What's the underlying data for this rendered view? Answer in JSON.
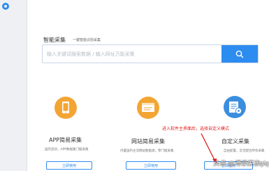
{
  "search": {
    "title": "智能采集",
    "hint": "一键智能识别采集",
    "placeholder": "输入关键词搜索数据 / 输入网址万能采集"
  },
  "cards": {
    "app": {
      "title": "APP简易采集",
      "desc": "国内首创，APP数据集门槛采集",
      "button": "立即使用"
    },
    "web": {
      "title": "网站简易采集",
      "desc": "内置国内主流网站数据源，零门槛采集",
      "button": "立即使用"
    },
    "custom": {
      "title": "自定义采集",
      "desc": "自由配置，灵活配合所有采集",
      "button": "立即使用"
    }
  },
  "annotation": {
    "text": "进入软件主界面后，选择自定义模式",
    "color": "#e02020"
  },
  "watermark": {
    "text": "头条 @渴尋果冻qiq"
  },
  "colors": {
    "accent": "#2d8cf0",
    "orange": "#f3a533"
  }
}
